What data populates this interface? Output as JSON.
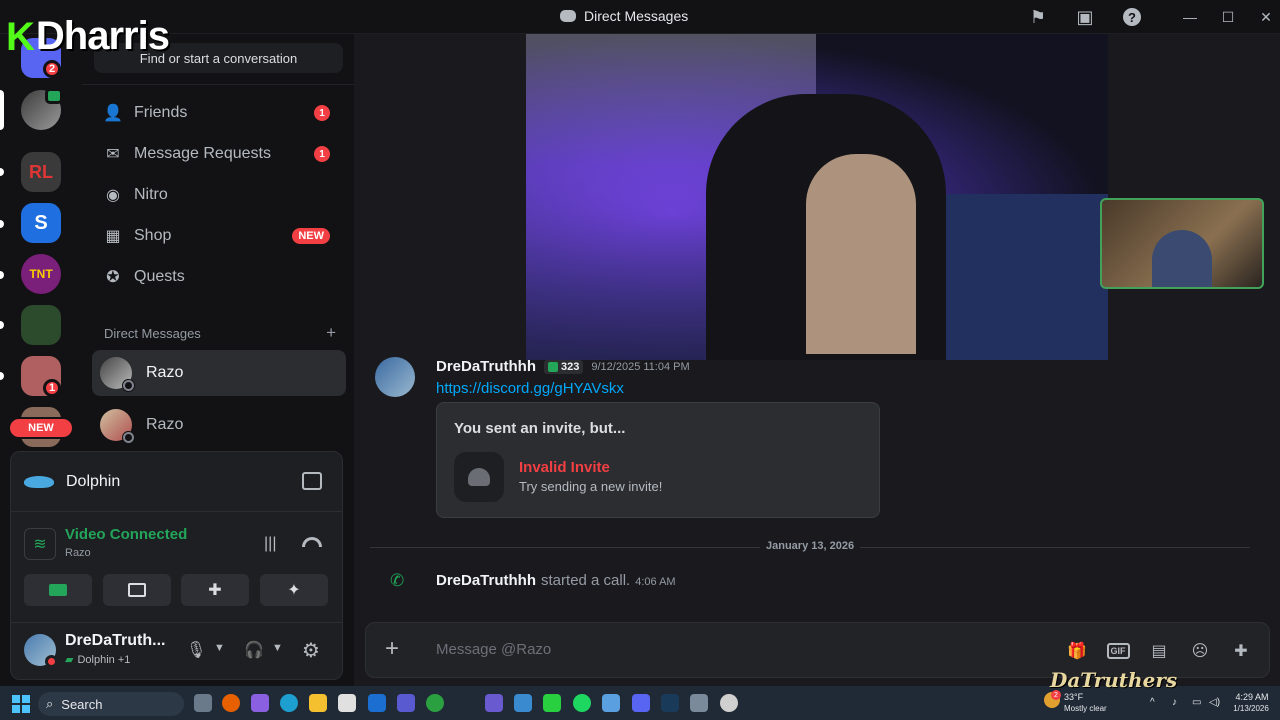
{
  "titlebar": {
    "title": "Direct Messages"
  },
  "watermark": {
    "k": "K",
    "name": "Dharris"
  },
  "rail": {
    "badge_dm": "2",
    "badge_server": "1",
    "new_label": "NEW"
  },
  "sidebar": {
    "search_placeholder": "Find or start a conversation",
    "nav": [
      {
        "label": "Friends",
        "badge": "1"
      },
      {
        "label": "Message Requests",
        "badge": "1"
      },
      {
        "label": "Nitro"
      },
      {
        "label": "Shop",
        "badge": "NEW"
      },
      {
        "label": "Quests"
      }
    ],
    "dm_header": "Direct Messages",
    "dm_add": "+",
    "dms": [
      {
        "name": "Razo"
      },
      {
        "name": "Razo"
      }
    ]
  },
  "panel": {
    "activity": "Dolphin",
    "voice_status": "Video Connected",
    "voice_channel": "Razo",
    "user_name": "DreDaTruth...",
    "user_activity": "Dolphin +1"
  },
  "messages": {
    "author": "DreDaTruthhh",
    "tag": "323",
    "timestamp": "9/12/2025 11:04 PM",
    "link": "https://discord.gg/gHYAVskx",
    "invite_title": "You sent an invite, but...",
    "invite_status": "Invalid Invite",
    "invite_hint": "Try sending a new invite!",
    "date_divider": "January 13, 2026",
    "call_author": "DreDaTruthhh",
    "call_text": "started a call.",
    "call_time": "4:06 AM"
  },
  "composer": {
    "placeholder": "Message @Razo"
  },
  "taskbar": {
    "search": "Search",
    "weather_temp": "33°F",
    "weather_desc": "Mostly clear",
    "weather_badge": "2",
    "time": "4:29 AM",
    "date": "1/13/2026",
    "overlay": "DaTruthers"
  },
  "colors": {
    "accent": "#5865f2",
    "green": "#23a55a",
    "red": "#f23f43",
    "link": "#00a8fc"
  }
}
